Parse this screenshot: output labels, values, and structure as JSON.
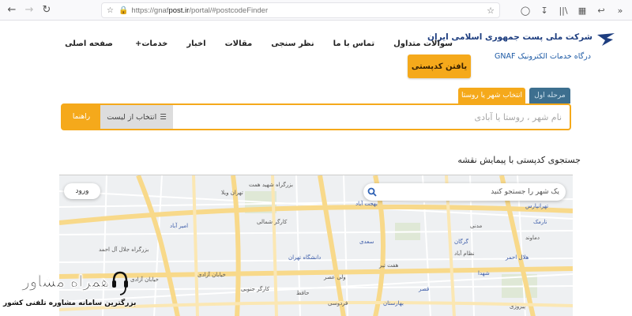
{
  "browser": {
    "url_prefix": "https://gnaf",
    "url_domain": "post.ir",
    "url_suffix": "/portal/#postcodeFinder"
  },
  "header": {
    "org_name": "شرکت ملی پست جمهوری اسلامی ایران",
    "subtitle": "درگاه خدمات الکترونیک GNAF",
    "nav": [
      {
        "label": "صفحه اصلی"
      },
      {
        "label": "خدمات",
        "has_plus": true
      },
      {
        "label": "اخبار"
      },
      {
        "label": "مقالات"
      },
      {
        "label": "نظر سنجی"
      },
      {
        "label": "تماس با ما"
      },
      {
        "label": "سوالات متداول"
      }
    ],
    "find_button": "یافتن کدپستی"
  },
  "search": {
    "step_tab": "مرحله اول",
    "city_tab": "انتخاب شهر یا روستا",
    "placeholder": "نام شهر ، روستا یا آبادی",
    "list_button": "انتخاب از لیست",
    "guide_button": "راهنما"
  },
  "map": {
    "title": "جستجوی کدپستی با پیمایش نقشه",
    "search_placeholder": "یک شهر را جستجو کنید",
    "login_button": "ورود",
    "labels": [
      "تهران ویلا",
      "بزرگراه شهید همت",
      "کارگر شمالی",
      "بزرگراه جلال آل احمد",
      "خیابان آزادی",
      "خیابان آزادی",
      "بهجت آباد",
      "دانشگاه تهران",
      "نظام آباد",
      "پیروزی",
      "ولی عصر",
      "فردوسی",
      "بهارستان",
      "سعدی",
      "دماوند",
      "تهرانپارس",
      "شهدا",
      "نارمک",
      "گرگان",
      "کارگر جنوبی",
      "هفت تیر",
      "مدنی",
      "امیر آباد",
      "قصر",
      "هلال احمر",
      "حافظ"
    ]
  },
  "watermark": {
    "brand": "همراه مشاور",
    "tagline": "بزرگترین سامانه مشاوره تلفنی کشور"
  },
  "colors": {
    "accent": "#f5a91b",
    "step_tab": "#3d6f8f",
    "brand_blue": "#1d3d7f"
  }
}
